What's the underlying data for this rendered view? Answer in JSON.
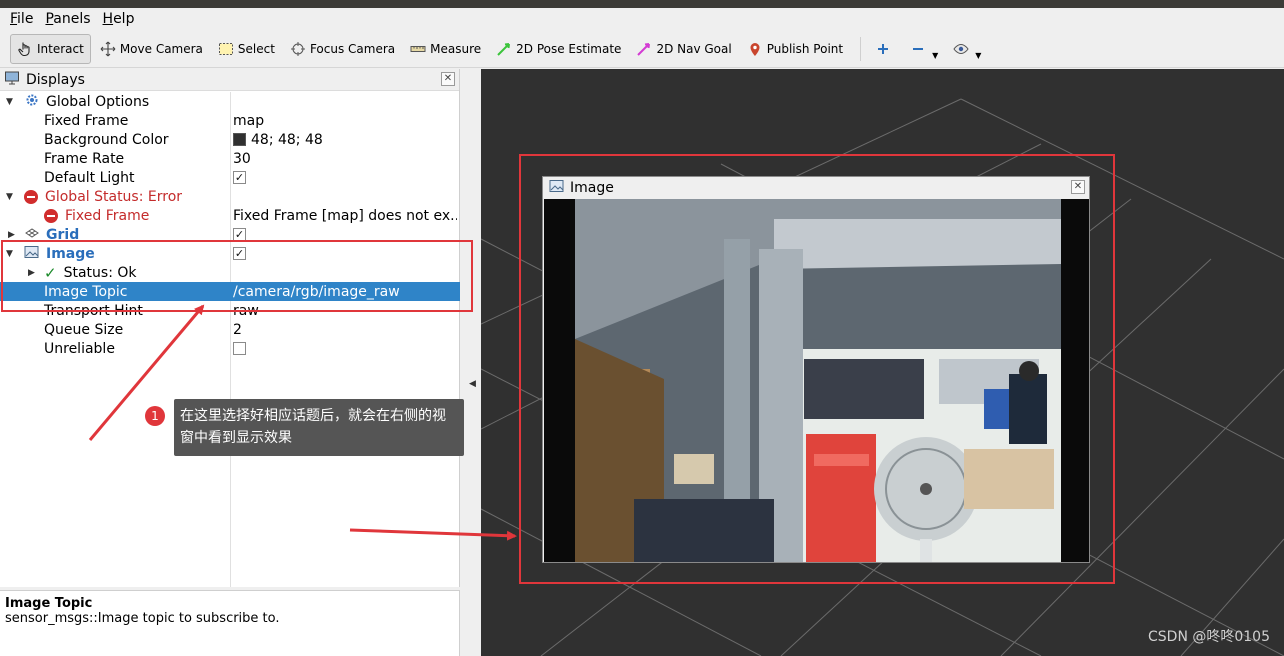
{
  "menu": [
    "File",
    "Panels",
    "Help"
  ],
  "toolbar": {
    "interact": "Interact",
    "move_camera": "Move Camera",
    "select": "Select",
    "focus_camera": "Focus Camera",
    "measure": "Measure",
    "pose_estimate": "2D Pose Estimate",
    "nav_goal": "2D Nav Goal",
    "publish_point": "Publish Point",
    "pose_color": "#3bc43b",
    "nav_color": "#d33bd3"
  },
  "displays": {
    "title": "Displays",
    "close": "✕",
    "rows": {
      "global_options": "Global Options",
      "fixed_frame_label": "Fixed Frame",
      "fixed_frame_value": "map",
      "bg_color_label": "Background Color",
      "bg_color_value": "48; 48; 48",
      "frame_rate_label": "Frame Rate",
      "frame_rate_value": "30",
      "default_light_label": "Default Light",
      "global_status": "Global Status: Error",
      "fixed_frame_error_label": "Fixed Frame",
      "fixed_frame_error_value": "Fixed Frame [map] does not ex...",
      "grid_label": "Grid",
      "image_label": "Image",
      "status_ok_label": "Status: Ok",
      "image_topic_label": "Image Topic",
      "image_topic_value": "/camera/rgb/image_raw",
      "transport_hint_label": "Transport Hint",
      "transport_hint_value": "raw",
      "queue_size_label": "Queue Size",
      "queue_size_value": "2",
      "unreliable_label": "Unreliable"
    },
    "checks": {
      "default_light": true,
      "grid": true,
      "image": true,
      "unreliable": false
    }
  },
  "help": {
    "title": "Image Topic",
    "text": "sensor_msgs::Image topic to subscribe to."
  },
  "image_window": {
    "title": "Image",
    "close": "✕"
  },
  "annotation": {
    "badge": "1",
    "text": "在这里选择好相应话题后，就会在右侧的视窗中看到显示效果"
  },
  "watermark": "CSDN @咚咚0105",
  "colors": {
    "highlight": "#e0363b",
    "selection": "#2f84c8",
    "background_3d": "#303030"
  }
}
